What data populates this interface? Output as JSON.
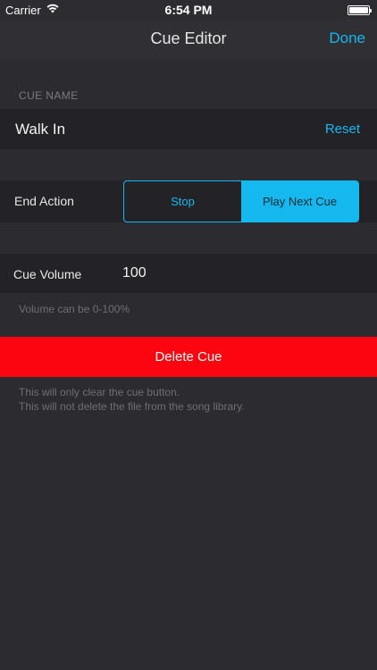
{
  "status_bar": {
    "carrier": "Carrier",
    "time": "6:54 PM"
  },
  "nav": {
    "title": "Cue Editor",
    "done_label": "Done"
  },
  "cue_name": {
    "header": "CUE NAME",
    "value": "Walk In",
    "reset_label": "Reset"
  },
  "end_action": {
    "label": "End Action",
    "options": [
      "Stop",
      "Play Next Cue"
    ],
    "selected": "Play Next Cue"
  },
  "volume": {
    "label": "Cue Volume",
    "value": "100",
    "hint": "Volume can be 0-100%"
  },
  "delete": {
    "label": "Delete Cue",
    "hint_line1": "This will only clear the cue button.",
    "hint_line2": "This will not delete the file from the song library."
  },
  "colors": {
    "accent": "#16b8f0",
    "destructive": "#fc0410",
    "background": "#2b2b30",
    "row": "#232327"
  },
  "icons": [
    "wifi-icon",
    "battery-icon"
  ]
}
